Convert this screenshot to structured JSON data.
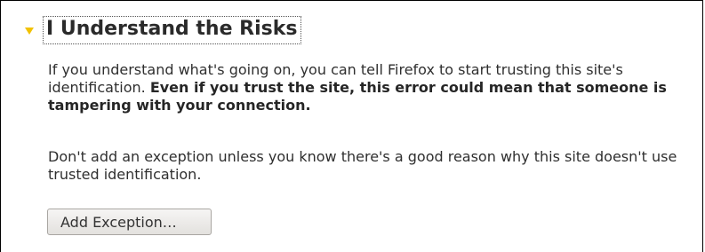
{
  "section": {
    "heading": "I Understand the Risks",
    "expanded": true,
    "twisty_color": "#f2c200"
  },
  "paragraph1": {
    "plain": "If you understand what's going on, you can tell Firefox to start trusting this site's identification. ",
    "bold": "Even if you trust the site, this error could mean that someone is tampering with your connection."
  },
  "paragraph2": {
    "text": "Don't add an exception unless you know there's a good reason why this site doesn't use trusted identification."
  },
  "button": {
    "label": "Add Exception…"
  }
}
